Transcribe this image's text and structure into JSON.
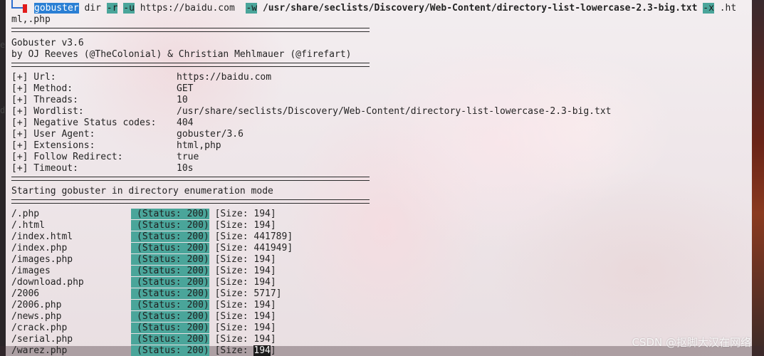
{
  "command": {
    "program": "gobuster",
    "mode": "dir",
    "flag_r": "-r",
    "flag_u": "-u",
    "url": "https://baidu.com",
    "flag_w": "-w",
    "wordlist_path": "/usr/share/seclists/Discovery/Web-Content/directory-list-lowercase-2.3-big.txt",
    "flag_x": "-x",
    "ext_part1": ".ht",
    "ext_part2": "ml,.php"
  },
  "banner": {
    "version": "Gobuster v3.6",
    "authors": "by OJ Reeves (@TheColonial) & Christian Mehlmauer (@firefart)"
  },
  "config": [
    {
      "label": "[+] Url:",
      "value": "https://baidu.com"
    },
    {
      "label": "[+] Method:",
      "value": "GET"
    },
    {
      "label": "[+] Threads:",
      "value": "10"
    },
    {
      "label": "[+] Wordlist:",
      "value": "/usr/share/seclists/Discovery/Web-Content/directory-list-lowercase-2.3-big.txt"
    },
    {
      "label": "[+] Negative Status codes:",
      "value": "404"
    },
    {
      "label": "[+] User Agent:",
      "value": "gobuster/3.6"
    },
    {
      "label": "[+] Extensions:",
      "value": "html,php"
    },
    {
      "label": "[+] Follow Redirect:",
      "value": "true"
    },
    {
      "label": "[+] Timeout:",
      "value": "10s"
    }
  ],
  "start_message": "Starting gobuster in directory enumeration mode",
  "results": [
    {
      "path": "/.php",
      "status": "(Status: 200)",
      "size_open": "[Size: ",
      "size": "194",
      "size_close": "]"
    },
    {
      "path": "/.html",
      "status": "(Status: 200)",
      "size_open": "[Size: ",
      "size": "194",
      "size_close": "]"
    },
    {
      "path": "/index.html",
      "status": "(Status: 200)",
      "size_open": "[Size: ",
      "size": "441789",
      "size_close": "]"
    },
    {
      "path": "/index.php",
      "status": "(Status: 200)",
      "size_open": "[Size: ",
      "size": "441949",
      "size_close": "]"
    },
    {
      "path": "/images.php",
      "status": "(Status: 200)",
      "size_open": "[Size: ",
      "size": "194",
      "size_close": "]"
    },
    {
      "path": "/images",
      "status": "(Status: 200)",
      "size_open": "[Size: ",
      "size": "194",
      "size_close": "]"
    },
    {
      "path": "/download.php",
      "status": "(Status: 200)",
      "size_open": "[Size: ",
      "size": "194",
      "size_close": "]"
    },
    {
      "path": "/2006",
      "status": "(Status: 200)",
      "size_open": "[Size: ",
      "size": "5717",
      "size_close": "]"
    },
    {
      "path": "/2006.php",
      "status": "(Status: 200)",
      "size_open": "[Size: ",
      "size": "194",
      "size_close": "]"
    },
    {
      "path": "/news.php",
      "status": "(Status: 200)",
      "size_open": "[Size: ",
      "size": "194",
      "size_close": "]"
    },
    {
      "path": "/crack.php",
      "status": "(Status: 200)",
      "size_open": "[Size: ",
      "size": "194",
      "size_close": "]"
    },
    {
      "path": "/serial.php",
      "status": "(Status: 200)",
      "size_open": "[Size: ",
      "size": "194",
      "size_close": "]"
    },
    {
      "path": "/warez.php",
      "status": "(Status: 200)",
      "size_open": "[Size: ",
      "size": "194",
      "size_close": "]"
    }
  ],
  "side_text": {
    "left_e": "e",
    "left_d": "d"
  },
  "watermark": "CSDN @抠脚大汉在网络",
  "colors": {
    "status_highlight": "#4aa59a",
    "command_highlight": "#2a7fd4",
    "prompt_mark": "#e21b1b"
  }
}
